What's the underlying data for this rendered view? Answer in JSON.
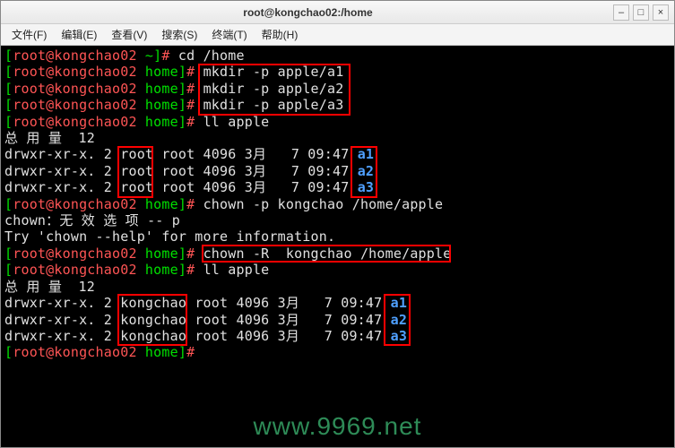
{
  "window": {
    "title": "root@kongchao02:/home"
  },
  "menubar": {
    "file": "文件(F)",
    "edit": "编辑(E)",
    "view": "查看(V)",
    "search": "搜索(S)",
    "terminal": "终端(T)",
    "help": "帮助(H)"
  },
  "winctl": {
    "min": "–",
    "max": "□",
    "close": "×"
  },
  "prompt": {
    "lbr": "[",
    "rbr": "]",
    "userhost": "root@kongchao02",
    "home_tilde": " ~",
    "home": " home",
    "hash": "# "
  },
  "cmd": {
    "cdhome": "cd /home",
    "mk1": "mkdir -p apple/a1",
    "mk2": "mkdir -p apple/a2",
    "mk3": "mkdir -p apple/a3",
    "ll": "ll apple",
    "chp": "chown -p kongchao /home/apple",
    "chR": "chown -R  kongchao /home/apple"
  },
  "out": {
    "total": "总 用 量  12",
    "invalid": "chown：无 效 选 项 -- p",
    "tryhelp": "Try 'chown --help' for more information."
  },
  "ls1": {
    "pre": "drwxr-xr-x. 2 ",
    "owner": "root",
    "rest": " root 4096 3月   7 09:47 ",
    "d1": "a1",
    "d2": "a2",
    "d3": "a3"
  },
  "ls2": {
    "pre": "drwxr-xr-x. 2 ",
    "owner": "kongchao",
    "rest": " root 4096 3月   7 09:47 ",
    "d1": "a1",
    "d2": "a2",
    "d3": "a3"
  },
  "watermark": "www.9969.net"
}
